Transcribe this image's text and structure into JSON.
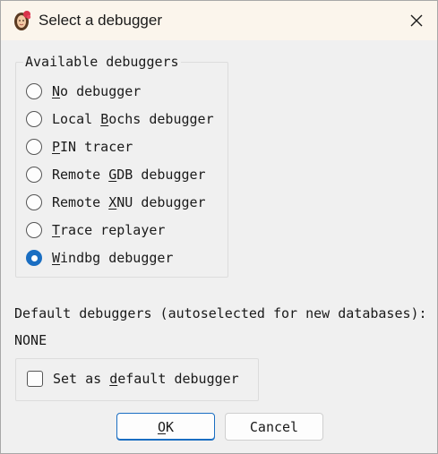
{
  "window": {
    "title": "Select a debugger"
  },
  "debuggers": {
    "group_title": "Available debuggers",
    "items": [
      {
        "pre": "",
        "u": "N",
        "post": "o debugger",
        "checked": false
      },
      {
        "pre": "Local ",
        "u": "B",
        "post": "ochs debugger",
        "checked": false
      },
      {
        "pre": "",
        "u": "P",
        "post": "IN tracer",
        "checked": false
      },
      {
        "pre": "Remote ",
        "u": "G",
        "post": "DB debugger",
        "checked": false
      },
      {
        "pre": "Remote ",
        "u": "X",
        "post": "NU debugger",
        "checked": false
      },
      {
        "pre": "",
        "u": "T",
        "post": "race replayer",
        "checked": false
      },
      {
        "pre": "",
        "u": "W",
        "post": "indbg debugger",
        "checked": true
      }
    ]
  },
  "defaults": {
    "label": "Default debuggers (autoselected for new databases):",
    "value": "NONE"
  },
  "set_default": {
    "pre": "Set as ",
    "u": "d",
    "post": "efault debugger",
    "checked": false
  },
  "buttons": {
    "ok_u": "O",
    "ok_post": "K",
    "cancel": "Cancel"
  },
  "colors": {
    "accent": "#1a6ec2",
    "titlebar": "#fbf5ec"
  }
}
